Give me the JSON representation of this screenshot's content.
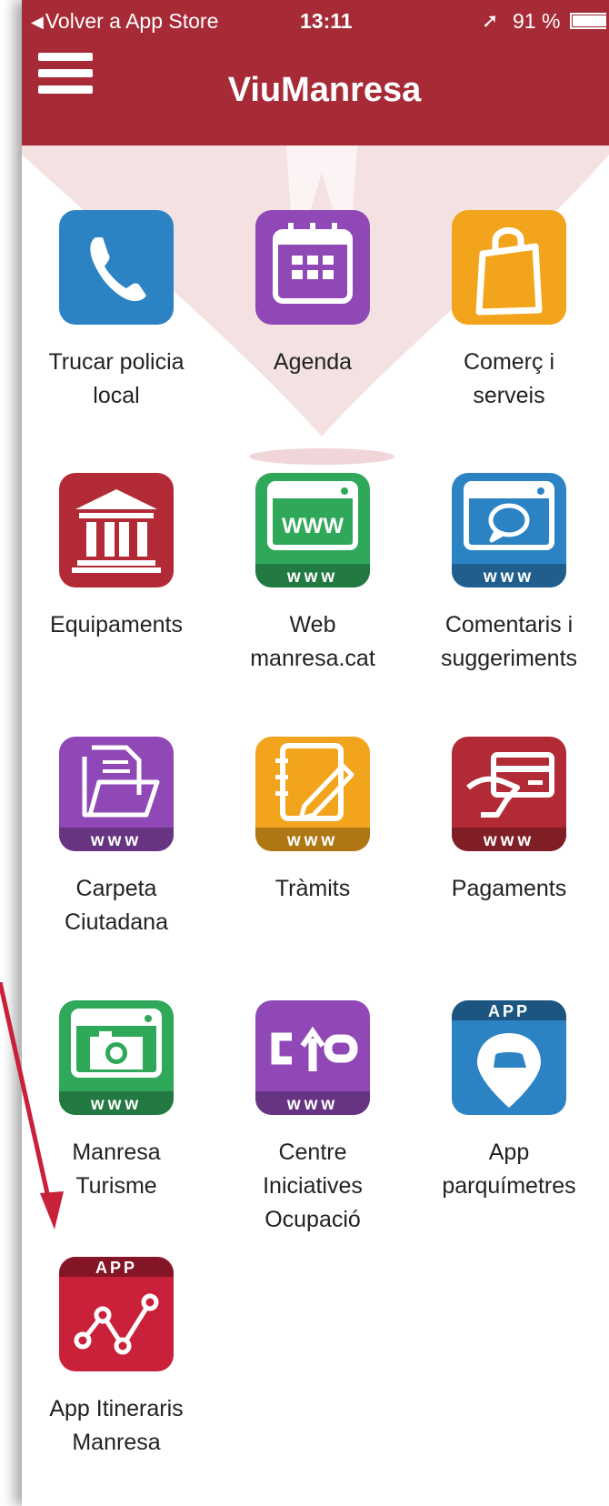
{
  "status_bar": {
    "back_label": "Volver a App Store",
    "time": "13:11",
    "battery": "91 %"
  },
  "header": {
    "title": "ViuManresa"
  },
  "colors": {
    "brand_red": "#a72a37",
    "blue": "#2b83c4",
    "purple": "#8f48b5",
    "orange": "#f2a51c",
    "green": "#2fa85a",
    "dark_red": "#b22a35",
    "bright_red": "#c9213a"
  },
  "tiles": [
    {
      "label": "Trucar policia\nlocal",
      "icon": "phone-icon",
      "color": "#2b83c4"
    },
    {
      "label": "Agenda",
      "icon": "calendar-icon",
      "color": "#8f48b5"
    },
    {
      "label": "Comerç i\nserveis",
      "icon": "shopping-bag-icon",
      "color": "#f2a51c"
    },
    {
      "label": "Equipaments",
      "icon": "building-icon",
      "color": "#b22a35"
    },
    {
      "label": "Web\nmanresa.cat",
      "icon": "web-browser-icon",
      "color": "#2fa85a",
      "badge": "www",
      "inner_text": "WWW"
    },
    {
      "label": "Comentaris i\nsuggeriments",
      "icon": "comment-icon",
      "color": "#2b83c4",
      "badge": "www"
    },
    {
      "label": "Carpeta\nCiutadana",
      "icon": "folder-icon",
      "color": "#8f48b5",
      "badge": "www"
    },
    {
      "label": "Tràmits",
      "icon": "notebook-pen-icon",
      "color": "#f2a51c",
      "badge": "www"
    },
    {
      "label": "Pagaments",
      "icon": "credit-card-icon",
      "color": "#b22a35",
      "badge": "www"
    },
    {
      "label": "Manresa\nTurisme",
      "icon": "camera-icon",
      "color": "#2fa85a",
      "badge": "www"
    },
    {
      "label": "Centre\nIniciatives\nOcupació",
      "icon": "cio-logo-icon",
      "color": "#8f48b5",
      "badge": "www"
    },
    {
      "label": "App\nparquímetres",
      "icon": "car-pin-icon",
      "color": "#2b83c4",
      "app_badge": "APP"
    },
    {
      "label": "App Itineraris\nManresa",
      "icon": "route-icon",
      "color": "#c9213a",
      "app_badge": "APP"
    }
  ]
}
